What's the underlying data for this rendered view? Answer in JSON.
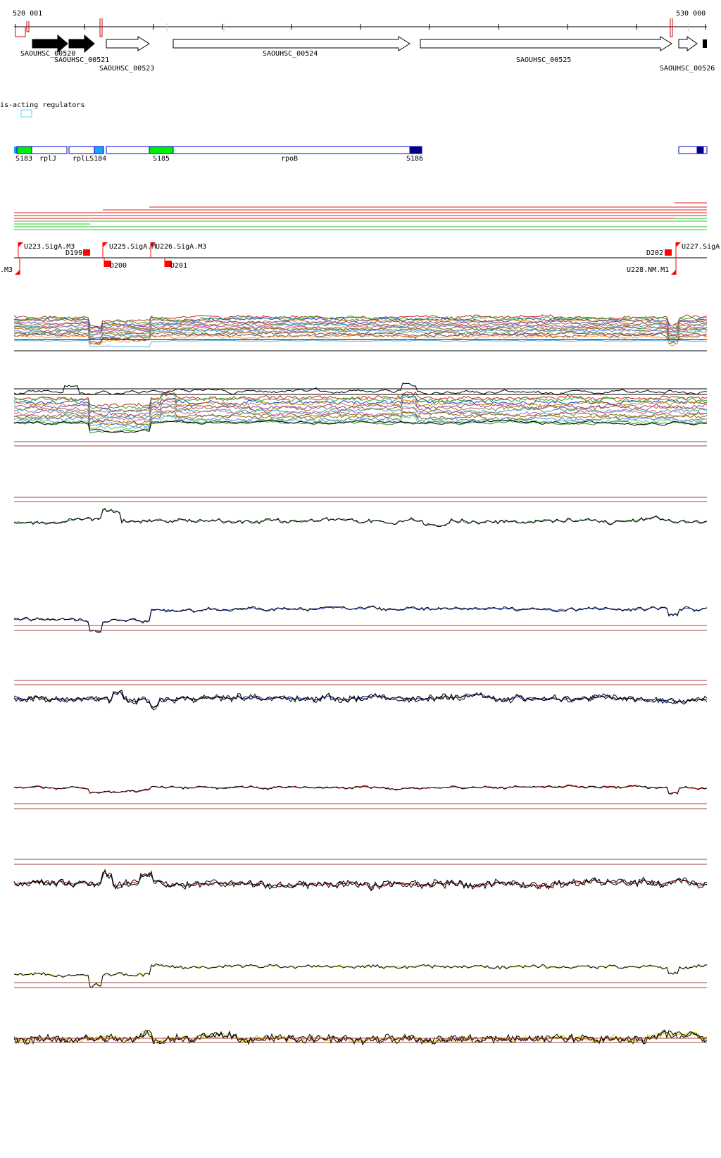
{
  "ruler": {
    "start_label": "520 001",
    "end_label": "530 000"
  },
  "genes": [
    {
      "id": "SAOUHSC_00520",
      "label": "SAOUHSC_00520",
      "filled": true
    },
    {
      "id": "SAOUHSC_00521",
      "label": "SAOUHSC_00521",
      "filled": true
    },
    {
      "id": "SAOUHSC_00523",
      "label": "SAOUHSC_00523",
      "filled": false
    },
    {
      "id": "SAOUHSC_00524",
      "label": "SAOUHSC_00524",
      "filled": false
    },
    {
      "id": "SAOUHSC_00525",
      "label": "SAOUHSC_00525",
      "filled": false
    },
    {
      "id": "SAOUHSC_00526",
      "label": "SAOUHSC_00526",
      "filled": false
    }
  ],
  "cis_regulators": {
    "title": "is-acting regulators"
  },
  "segments": {
    "labels": [
      "S183",
      "rplJ",
      "rplLS184",
      "S185",
      "rpoB",
      "S186"
    ]
  },
  "promoters": {
    "up": [
      "U223.SigA.M3",
      "U225.SigA.M",
      "U226.SigA.M3",
      "U227.SigA"
    ],
    "down": [
      ".M3",
      "U228.NM.M1"
    ],
    "boxes": [
      "D199",
      "D200",
      "D201",
      "D202"
    ]
  },
  "colors": {
    "ruler": "#000000",
    "regulator_tick": "#cc0000",
    "segment_blue": "#0000cc",
    "segment_green": "#00ee00",
    "segment_navy": "#000080",
    "segment_lightblue": "#1ea0ff",
    "transcript_red": "#dd2222",
    "transcript_green": "#22cc22",
    "promoter": "#ff0000",
    "threshold": "#a04040",
    "track_green": "#2a8a2a",
    "track_blue": "#1a3cc8",
    "track_red": "#cc1010",
    "track_yellow": "#d8d820",
    "track_black": "#000000"
  }
}
